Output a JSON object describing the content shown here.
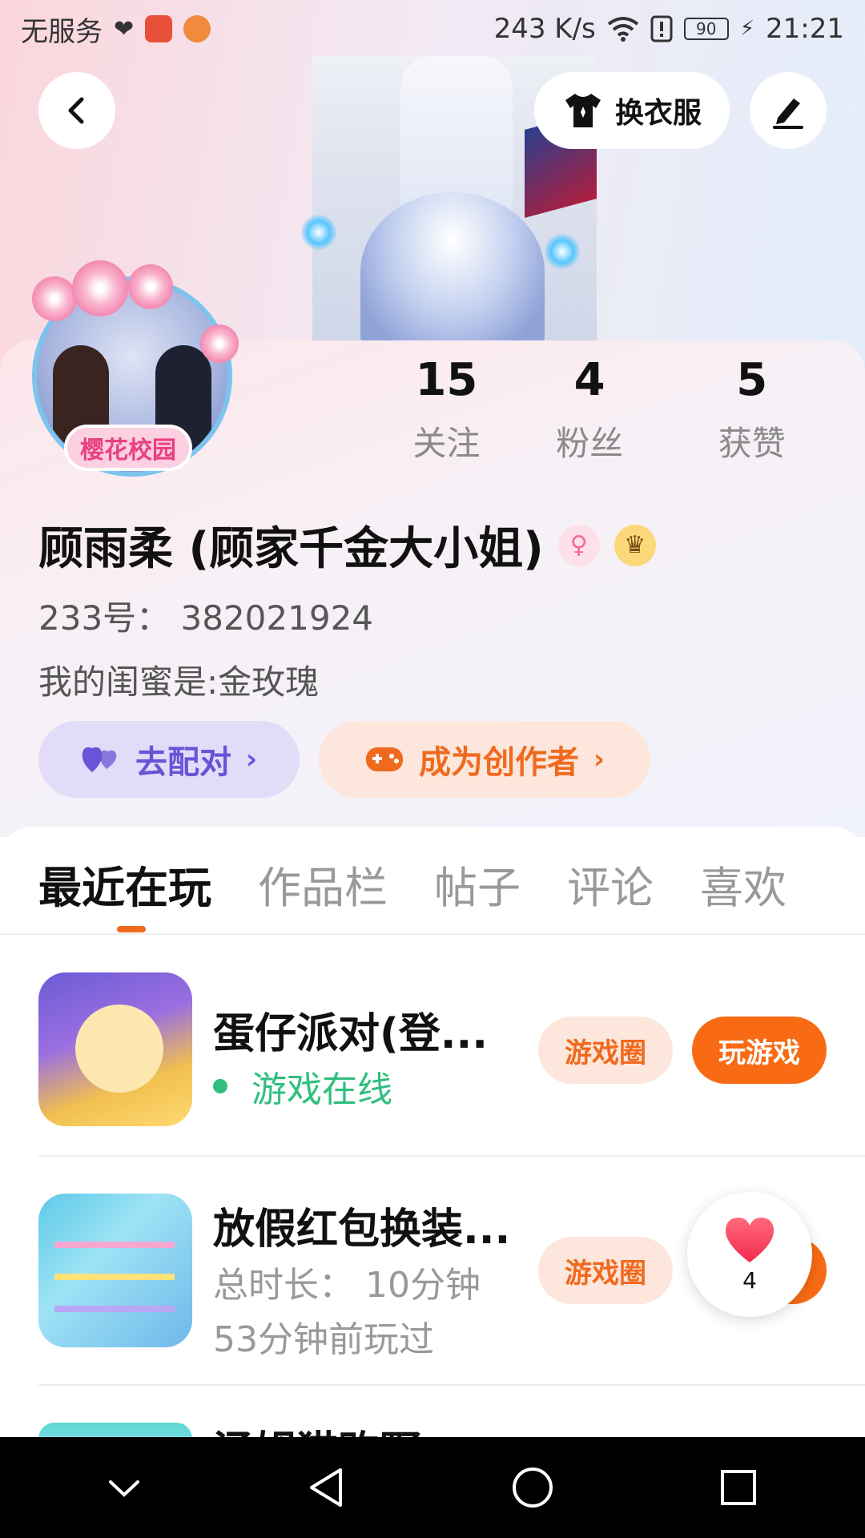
{
  "statusbar": {
    "carrier": "无服务",
    "speed": "243 K/s",
    "battery": "90",
    "time": "21:21"
  },
  "header": {
    "outfit_label": "换衣服"
  },
  "profile": {
    "avatar_badge": "樱花校园",
    "stats": [
      {
        "num": "15",
        "label": "关注"
      },
      {
        "num": "4",
        "label": "粉丝"
      },
      {
        "num": "5",
        "label": "获赞"
      }
    ],
    "name": "顾雨柔 (顾家千金大小姐)",
    "id_line": "233号： 382021924",
    "bio": "我的闺蜜是:金玫瑰",
    "match_label": "去配对",
    "creator_label": "成为创作者"
  },
  "tabs": [
    "最近在玩",
    "作品栏",
    "帖子",
    "评论",
    "喜欢"
  ],
  "games": [
    {
      "title": "蛋仔派对(登...",
      "status": "游戏在线",
      "circle_label": "游戏圈",
      "play_label": "玩游戏"
    },
    {
      "title": "放假红包换装...",
      "duration": "总时长： 10分钟",
      "last_played": "53分钟前玩过",
      "circle_label": "游戏圈"
    },
    {
      "title": "涵姆猫购野"
    }
  ],
  "floating_like": {
    "count": "4"
  },
  "colors": {
    "accent_orange": "#f86b14",
    "online_green": "#2fbf7e",
    "match_purple": "#6a53d6"
  }
}
